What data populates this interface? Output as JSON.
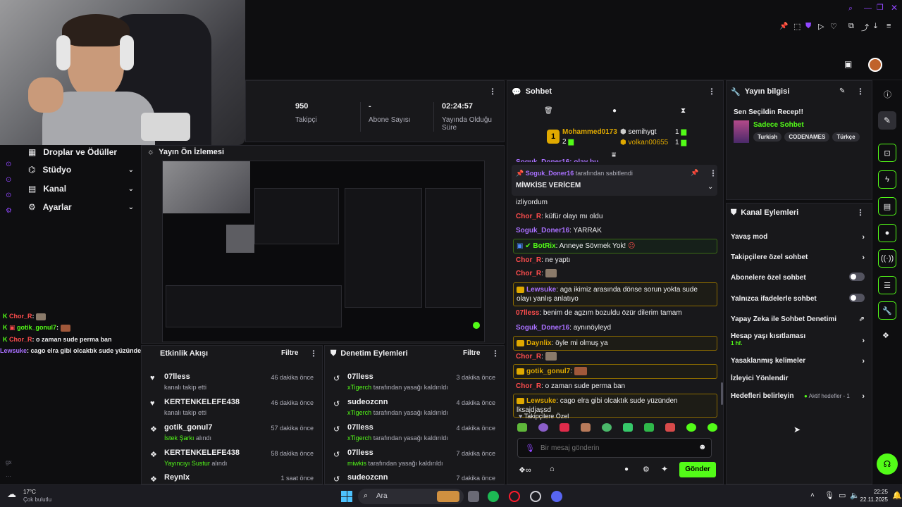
{
  "title_bar": {
    "icons": [
      "search-icon",
      "minimize-icon",
      "maximize-icon",
      "close-icon"
    ]
  },
  "stats": {
    "followers_value": "950",
    "followers_label": "Takipçi",
    "subs_value": "-",
    "subs_label": "Abone Sayısı",
    "uptime_value": "02:24:57",
    "uptime_label_1": "Yayında Olduğu",
    "uptime_label_2": "Süre"
  },
  "nav": {
    "items": [
      {
        "label": "Droplar ve Ödüller"
      },
      {
        "label": "Stüdyo"
      },
      {
        "label": "Kanal"
      },
      {
        "label": "Ayarlar"
      }
    ]
  },
  "preview": {
    "title": "Yayın Ön İzlemesi"
  },
  "activity": {
    "title": "Etkinlik Akışı",
    "filter": "Filtre",
    "rows": [
      {
        "name": "07lless",
        "sub": "kanalı takip etti",
        "time": "46 dakika önce"
      },
      {
        "name": "KERTENKELEFE438",
        "sub": "kanalı takip etti",
        "time": "46 dakika önce"
      },
      {
        "name": "gotik_gonul7",
        "sub": "İstek Şarkı",
        "sub2": " alındı",
        "time": "57 dakika önce"
      },
      {
        "name": "KERTENKELEFE438",
        "sub": "Yayıncıyı Sustur",
        "sub2": " alındı",
        "time": "58 dakika önce"
      },
      {
        "name": "Reynlx",
        "sub": "",
        "time": "1 saat önce"
      }
    ]
  },
  "moderation": {
    "title": "Denetim Eylemleri",
    "filter": "Filtre",
    "rows": [
      {
        "name": "07lless",
        "by": "xTigerch",
        "action": " tarafından yasağı kaldırıldı",
        "time": "3 dakika önce"
      },
      {
        "name": "sudeozcnn",
        "by": "xTigerch",
        "action": " tarafından yasağı kaldırıldı",
        "time": "4 dakika önce"
      },
      {
        "name": "07lless",
        "by": "xTigerch",
        "action": " tarafından yasağı kaldırıldı",
        "time": "4 dakika önce"
      },
      {
        "name": "07lless",
        "by": "miwkis",
        "action": " tarafından yasağı kaldırıldı",
        "time": "7 dakika önce"
      },
      {
        "name": "sudeozcnn",
        "by": "",
        "action": "",
        "time": "7 dakika önce"
      }
    ]
  },
  "chat": {
    "title": "Sohbet",
    "leaderboard": {
      "first_name": "Mohammed0173",
      "first_count": "2",
      "second_name": "semihygt",
      "second_count": "1",
      "third_name": "volkan00655",
      "third_count": "1"
    },
    "pinned": {
      "by": "Soguk_Doner16",
      "by_text": "tarafından sabitlendi",
      "message": "MİWKİSE VERİCEM"
    },
    "partial_top": "Soguk_Doner16: olay bu",
    "messages": [
      {
        "user": "",
        "text": "izliyordum"
      },
      {
        "user": "Chor_R",
        "text": ": küfür olayı mı oldu"
      },
      {
        "user": "Soguk_Doner16",
        "text": ": YARRAK"
      },
      {
        "user": "BotRix",
        "text": ": Anneye Sövmek Yok!"
      },
      {
        "user": "Chor_R",
        "text": ": ne yaptı"
      },
      {
        "user": "Chor_R",
        "text": ":"
      },
      {
        "user": "Lewsuke",
        "text": ": aga ikimiz arasında dönse sorun yokta sude olayı yanlış anlatıyo"
      },
      {
        "user": "07lless",
        "text": ": benim de agzım bozuldu özür dilerim tamam"
      },
      {
        "user": "Soguk_Doner16",
        "text": ": aynınöyleyd"
      },
      {
        "user": "Daynlix",
        "text": ": öyle mi olmuş ya"
      },
      {
        "user": "Chor_R",
        "text": ":"
      },
      {
        "user": "gotik_gonul7",
        "text": ":"
      },
      {
        "user": "Chor_R",
        "text": ": o zaman sude perma ban"
      },
      {
        "user": "Lewsuke",
        "text": ": cago elra gibi olcaktık sude yüzünden lksajdjaşsd"
      }
    ],
    "emote_tab": "Takipçilere Özel",
    "input_placeholder": "Bir mesaj gönderin",
    "send_label": "Gönder"
  },
  "stream_info": {
    "title": "Yayın bilgisi",
    "stream_title": "Sen Seçildin Recep!!",
    "category": "Sadece Sohbet",
    "tags": [
      "Turkish",
      "CODENAMES",
      "Türkçe"
    ]
  },
  "channel_actions": {
    "title": "Kanal Eylemleri",
    "items": [
      {
        "label": "Yavaş mod",
        "kind": "arrow"
      },
      {
        "label": "Takipçilere özel sohbet",
        "kind": "arrow"
      },
      {
        "label": "Abonelere özel sohbet",
        "kind": "toggle"
      },
      {
        "label": "Yalnızca ifadelerle sohbet",
        "kind": "toggle"
      },
      {
        "label": "Yapay Zeka ile Sohbet Denetimi",
        "kind": "external"
      },
      {
        "label": "Hesap yaşı kısıtlaması",
        "sub": "1 hf.",
        "kind": "arrow"
      },
      {
        "label": "Yasaklanmış kelimeler",
        "kind": "arrow"
      },
      {
        "label": "İzleyici Yönlendir",
        "kind": "none"
      },
      {
        "label": "Hedefleri belirleyin",
        "extra": "Aktif hedefler - 1",
        "kind": "arrow"
      }
    ]
  },
  "overlay_chat": [
    {
      "user": "Chor_R",
      "text": ":"
    },
    {
      "user": "gotik_gonul7",
      "text": ":"
    },
    {
      "user": "Chor_R",
      "text": ": o zaman sude perma ban"
    },
    {
      "user": "Lewsuke",
      "text": ": cago elra gibi olcaktık sude yüzünden lksajdjaşsd"
    }
  ],
  "taskbar": {
    "weather_temp": "17°C",
    "weather_desc": "Çok bulutlu",
    "search_placeholder": "Ara",
    "time": "22:25",
    "date": "22.11.2025"
  },
  "colors": {
    "accent": "#53fc18",
    "bg": "#0e0e10",
    "panel": "#18181b",
    "username_purple": "#a970ff",
    "username_red": "#ff4d4d",
    "gold": "#e0a900"
  }
}
